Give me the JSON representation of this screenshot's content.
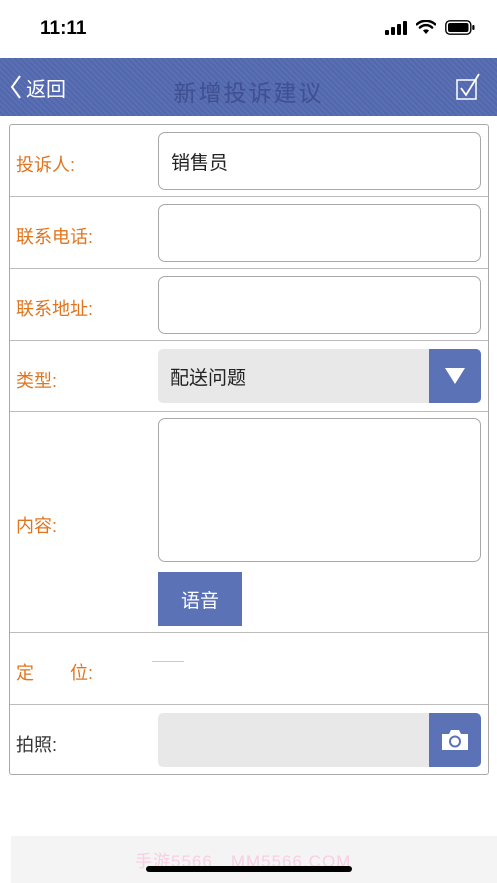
{
  "status": {
    "time": "11:11"
  },
  "nav": {
    "back_label": "返回",
    "title": "新增投诉建议"
  },
  "form": {
    "complainant": {
      "label": "投诉人:",
      "value": "销售员"
    },
    "phone": {
      "label": "联系电话:",
      "value": ""
    },
    "address": {
      "label": "联系地址:",
      "value": ""
    },
    "type": {
      "label": "类型:",
      "value": "配送问题"
    },
    "content": {
      "label": "内容:",
      "value": "",
      "voice_label": "语音"
    },
    "location": {
      "label": "定　　位:"
    },
    "photo": {
      "label": "拍照:"
    }
  },
  "footer": {
    "watermark": "手游5566　MM5566.COM"
  },
  "colors": {
    "accent": "#5c72b6",
    "label_orange": "#e0751f",
    "nav_title": "#3f4f90"
  }
}
